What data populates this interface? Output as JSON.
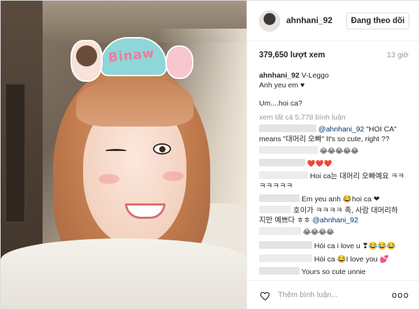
{
  "post": {
    "username": "ahnhani_92",
    "follow_label": "Đang theo dõi",
    "views": "379,650 lượt xem",
    "time_ago": "13 giờ"
  },
  "caption": {
    "user": "ahnhani_92",
    "text": "V-Leggo",
    "line2": "Anh yeu em ♥",
    "line3": "Um....hoi ca?"
  },
  "view_all": "xem tất cả 5,778 bình luận",
  "comments": [
    {
      "mention": "@ahnhani_92",
      "text": "\"HOI CA\""
    },
    {
      "text": "means \"대머리 오빠\" It's so cute, right ??"
    },
    {
      "text": "😂😂😂😂😂"
    },
    {
      "text": "❤️❤️❤️"
    },
    {
      "text": "Hoi ca는 대머리 오빠예요 ㅋㅋ"
    },
    {
      "text": "ㅋㅋㅋㅋㅋ"
    },
    {
      "text": "Em yeu anh 😂hoi ca ❤"
    },
    {
      "text": "호이가 ㅋㅋㅋㅋ 족, 사람 대머리하"
    },
    {
      "text": "지만 예쁘다 ㅎㅎ",
      "mention": "@ahnhani_92"
    },
    {
      "text": "😂😂😂😂"
    },
    {
      "text": "Hói ca i love u ❣😂😂😂"
    },
    {
      "text": "Hói ca 😂I love you 💕"
    },
    {
      "text": "Yours so cute unnie"
    }
  ],
  "footer": {
    "add_comment_placeholder": "Thêm bình luận...",
    "more": "ooo"
  },
  "headband": {
    "text": "Binaw"
  },
  "colors": {
    "text": "#262626",
    "muted": "#999999",
    "mention": "#003569",
    "border": "#dbdbdb"
  }
}
